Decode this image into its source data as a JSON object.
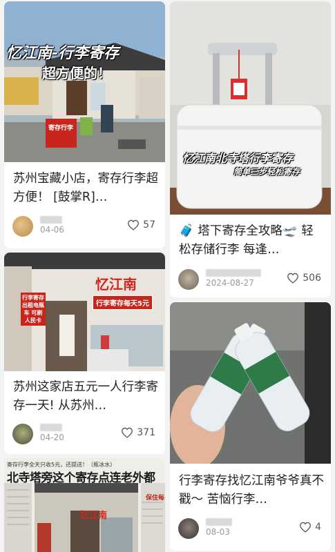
{
  "cards": [
    {
      "image_caption_line1": "忆江南-行李寄存",
      "image_caption_line2": "超方便的！",
      "image_board_text": "寄存行李",
      "title": "苏州宝藏小店，寄存行李超方便！ [鼓掌R]…",
      "date": "04-06",
      "likes": "57"
    },
    {
      "image_caption_line1": "忆江南北寺塔行李寄存",
      "image_caption_line2": "简单三步轻松寄存",
      "title": "🧳 塔下寄存全攻略🛫 轻松存储行李 每逢…",
      "date": "2024-08-27",
      "likes": "506"
    },
    {
      "image_sign": "忆江南",
      "image_banner": "行李寄存每天5元",
      "image_side_sign": "行李寄存 出租电瓶车 可刷人民卡",
      "title": "苏州这家店五元一人行李寄存一天! 从苏州…",
      "date": "04-20",
      "likes": "371"
    },
    {
      "title": "行李寄存找忆江南爷爷真不戳～ 苦恼行李…",
      "date": "08-03",
      "likes": "4"
    },
    {
      "image_small_text": "寄存行李全天只收5元，还提送！（瓶冰水）",
      "image_headline": "北寺塔旁这个寄存点连老外都",
      "image_sign": "忆江南",
      "image_side_text": "保住每"
    }
  ],
  "colors": {
    "background": "#f3f3f3",
    "card": "#ffffff",
    "accent_red": "#d1261a",
    "meta_text": "#9a9a9a"
  },
  "icons": [
    "heart-outline-icon",
    "avatar"
  ]
}
